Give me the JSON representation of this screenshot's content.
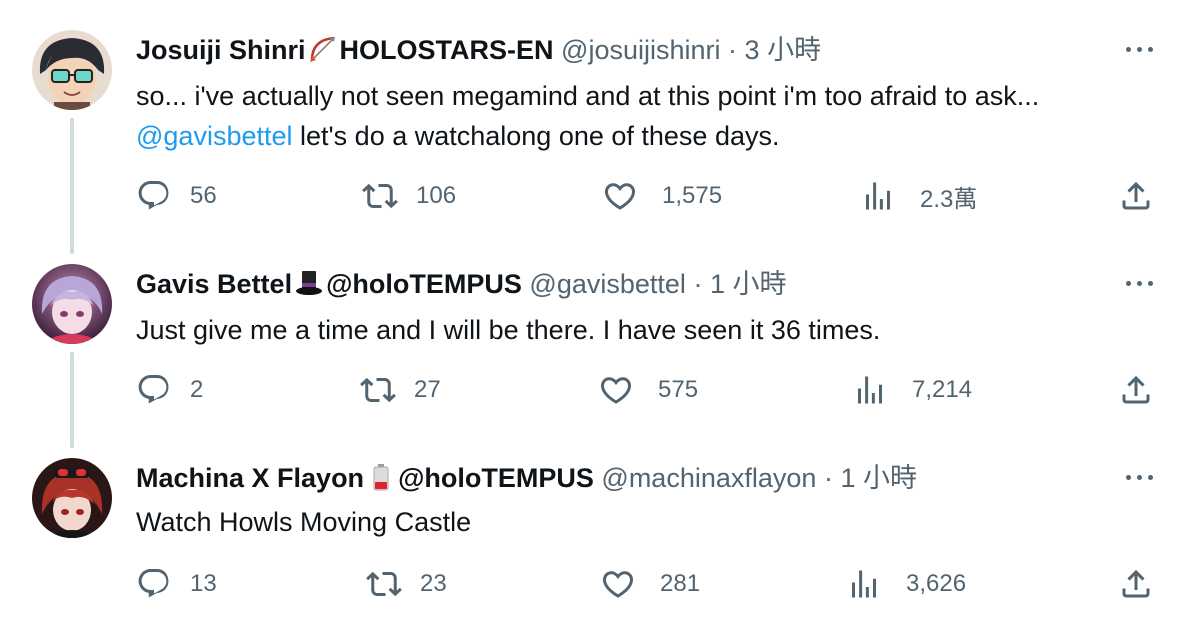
{
  "tweets": [
    {
      "name": "Josuiji Shinri",
      "tag": "HOLOSTARS-EN",
      "handle": "@josuijishinri",
      "sep": "·",
      "time": "3 小時",
      "text_before": "so... i've actually not seen megamind and at this point i'm too afraid to ask... ",
      "mention": "@gavisbettel",
      "text_after": " let's do a watchalong one of these days.",
      "replies": "56",
      "retweets": "106",
      "likes": "1,575",
      "views": "2.3萬"
    },
    {
      "name": "Gavis Bettel",
      "tag": "@holoTEMPUS",
      "handle": "@gavisbettel",
      "sep": "·",
      "time": "1 小時",
      "text": "Just give me a time and I will be there. I have seen it 36 times.",
      "replies": "2",
      "retweets": "27",
      "likes": "575",
      "views": "7,214"
    },
    {
      "name": "Machina X Flayon",
      "tag": "@holoTEMPUS",
      "handle": "@machinaxflayon",
      "sep": "·",
      "time": "1 小時",
      "text": "Watch Howls Moving Castle",
      "replies": "13",
      "retweets": "23",
      "likes": "281",
      "views": "3,626"
    }
  ],
  "icons": {
    "reply": "reply-icon",
    "retweet": "retweet-icon",
    "like": "heart-icon",
    "views": "views-icon",
    "share": "share-icon",
    "more": "more-icon"
  },
  "colors": {
    "text": "#0f1419",
    "secondary": "#536471",
    "link": "#1d9bf0",
    "thread_line": "#cfd9de"
  }
}
